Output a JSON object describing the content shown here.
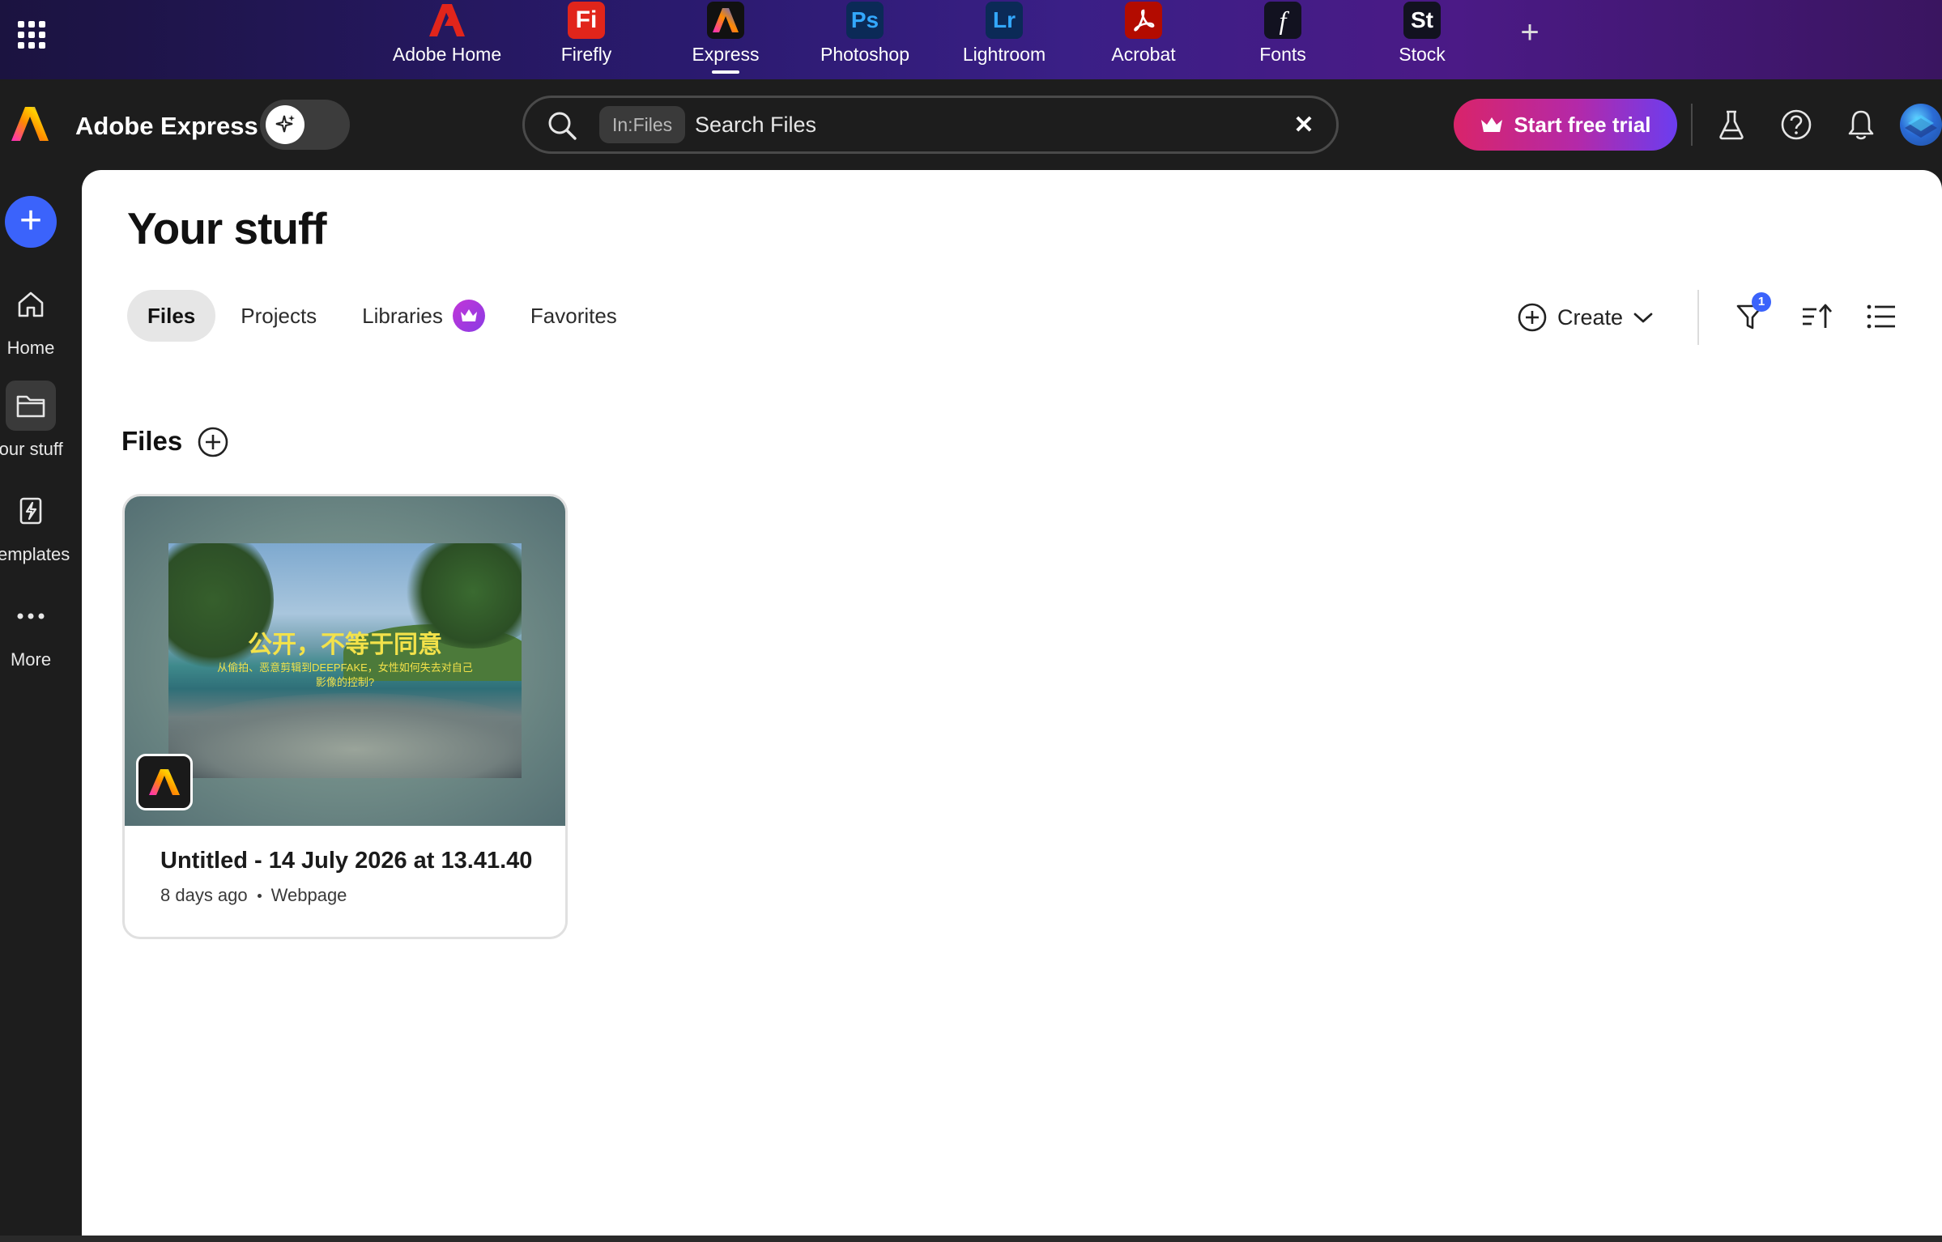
{
  "app_switcher": {
    "apps": [
      {
        "name": "Adobe Home",
        "icon": "adobe-logo-icon",
        "tile_text": "",
        "color": "#e1251b"
      },
      {
        "name": "Firefly",
        "icon": "firefly-icon",
        "tile_text": "Fi",
        "color": "#e1251b"
      },
      {
        "name": "Express",
        "icon": "express-icon",
        "tile_text": "",
        "color": "#111111",
        "active": true
      },
      {
        "name": "Photoshop",
        "icon": "photoshop-icon",
        "tile_text": "Ps",
        "color": "#0b2a57"
      },
      {
        "name": "Lightroom",
        "icon": "lightroom-icon",
        "tile_text": "Lr",
        "color": "#0b2a57"
      },
      {
        "name": "Acrobat",
        "icon": "acrobat-icon",
        "tile_text": "",
        "color": "#b30b00"
      },
      {
        "name": "Fonts",
        "icon": "fonts-icon",
        "tile_text": "f",
        "color": "#121212"
      },
      {
        "name": "Stock",
        "icon": "stock-icon",
        "tile_text": "St",
        "color": "#121212"
      }
    ],
    "more_symbol": "+"
  },
  "header": {
    "brand": "Adobe Express",
    "search": {
      "scope": "In:Files",
      "placeholder": "Search Files",
      "value": ""
    },
    "trial_label": "Start free trial",
    "icons": [
      "labs-icon",
      "help-icon",
      "bell-icon",
      "avatar"
    ]
  },
  "rail": {
    "add_symbol": "+",
    "items": [
      {
        "label": "Home",
        "icon": "home-icon"
      },
      {
        "label": "Your stuff",
        "icon": "folder-icon",
        "active": true
      },
      {
        "label": "Templates",
        "icon": "templates-icon"
      },
      {
        "label": "More",
        "icon": "more-icon"
      }
    ]
  },
  "main": {
    "title": "Your stuff",
    "tabs": [
      {
        "label": "Files",
        "active": true
      },
      {
        "label": "Projects"
      },
      {
        "label": "Libraries",
        "premium": true
      },
      {
        "label": "Favorites"
      }
    ],
    "create_label": "Create",
    "filter_count": "1",
    "section_title": "Files",
    "files": [
      {
        "title": "Untitled - 14 July 2026 at 13.41.40",
        "modified": "8 days ago",
        "type": "Webpage",
        "thumb_heading": "公开，不等于同意",
        "thumb_sub": "从偷拍、恶意剪辑到DEEPFAKE，女性如何失去对自己影像的控制?"
      }
    ]
  },
  "colors": {
    "accent_blue": "#3b63fb",
    "trial_start": "#d9246a",
    "trial_end": "#6b3df0"
  }
}
